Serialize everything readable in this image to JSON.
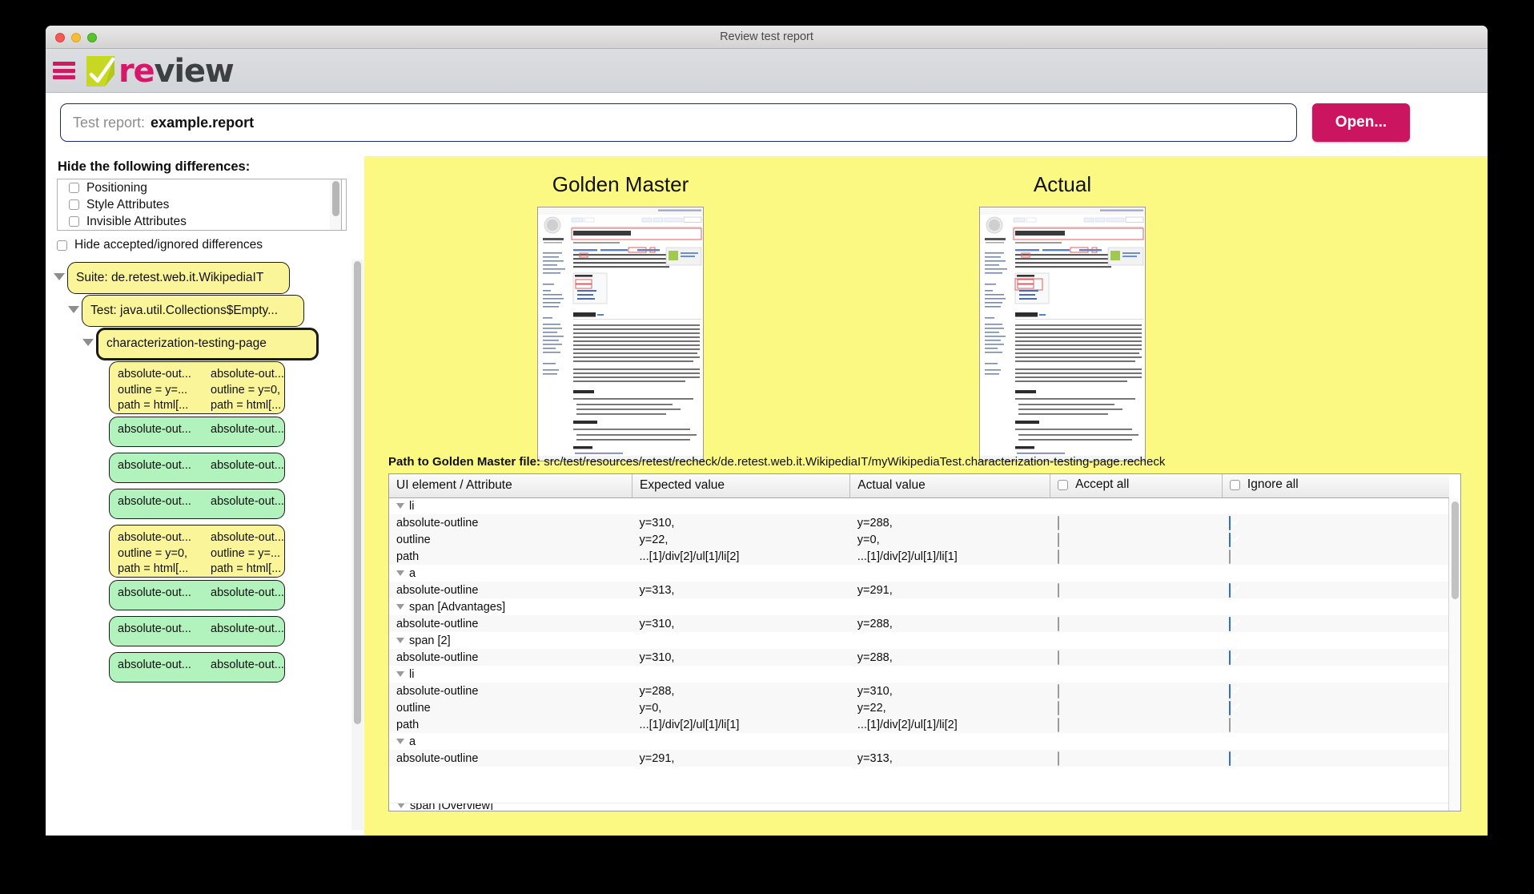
{
  "window": {
    "title": "Review test report",
    "traffic_lights": [
      "close-red",
      "minimize-yellow",
      "maximize-green"
    ]
  },
  "header": {
    "menu_icon": "hamburger-menu-icon",
    "logo_text_1": "re",
    "logo_text_2": "view",
    "logo_mark": "check-mark-icon",
    "brand_pink": "#cc1a63",
    "brand_green": "#c6d822",
    "brand_dark": "#3c4043"
  },
  "toolbar": {
    "report_label": "Test report:",
    "report_value": "example.report",
    "open_label": "Open...",
    "open_color": "#cc1560"
  },
  "filters": {
    "heading": "Hide the following differences:",
    "options": [
      {
        "label": "Positioning",
        "checked": false
      },
      {
        "label": "Style Attributes",
        "checked": false
      },
      {
        "label": "Invisible Attributes",
        "checked": false
      }
    ],
    "hide_accepted": {
      "label": "Hide accepted/ignored differences",
      "checked": false
    }
  },
  "tree": {
    "suite": "Suite: de.retest.web.it.WikipediaIT",
    "test": "Test:  java.util.Collections$Empty...",
    "state": "characterization-testing-page",
    "diffs": [
      {
        "color": "yellow",
        "rows": [
          [
            "absolute-out...",
            "absolute-out..."
          ],
          [
            "outline = y=...",
            "outline = y=0,"
          ],
          [
            "path = html[...",
            "path = html[..."
          ]
        ]
      },
      {
        "color": "green",
        "rows": [
          [
            "absolute-out...",
            "absolute-out..."
          ]
        ]
      },
      {
        "color": "green",
        "rows": [
          [
            "absolute-out...",
            "absolute-out..."
          ]
        ]
      },
      {
        "color": "green",
        "rows": [
          [
            "absolute-out...",
            "absolute-out..."
          ]
        ]
      },
      {
        "color": "yellow",
        "rows": [
          [
            "absolute-out...",
            "absolute-out..."
          ],
          [
            "outline = y=0,",
            "outline = y=..."
          ],
          [
            "path = html[...",
            "path = html[..."
          ]
        ]
      },
      {
        "color": "green",
        "rows": [
          [
            "absolute-out...",
            "absolute-out..."
          ]
        ]
      },
      {
        "color": "green",
        "rows": [
          [
            "absolute-out...",
            "absolute-out..."
          ]
        ]
      },
      {
        "color": "green",
        "rows": [
          [
            "absolute-out...",
            "absolute-out..."
          ]
        ]
      }
    ]
  },
  "compare": {
    "golden_title": "Golden Master",
    "actual_title": "Actual",
    "golden_page_title": "Characterization test",
    "actual_page_title": "Difference testing",
    "page_subtitle": "From Wikipedia, the free encyclopedia",
    "section_heading": "Overview",
    "background": "#fcf982"
  },
  "path_line": {
    "label": "Path to Golden Master file:",
    "value": "src/test/resources/retest/recheck/de.retest.web.it.WikipediaIT/myWikipediaTest.characterization-testing-page.recheck"
  },
  "table": {
    "columns": [
      "UI element / Attribute",
      "Expected value",
      "Actual value",
      "Accept all",
      "Ignore all"
    ],
    "accept_all_checked": false,
    "ignore_all_checked": false,
    "rows": [
      {
        "kind": "node",
        "element": "li"
      },
      {
        "kind": "attr",
        "element": "absolute-outline",
        "expected": "y=310,",
        "actual": "y=288,",
        "accept": false,
        "ignore": true
      },
      {
        "kind": "attr",
        "element": "outline",
        "expected": "y=22,",
        "actual": "y=0,",
        "accept": false,
        "ignore": true
      },
      {
        "kind": "attr",
        "element": "path",
        "expected": "...[1]/div[2]/ul[1]/li[2]",
        "actual": "...[1]/div[2]/ul[1]/li[1]",
        "accept": false,
        "ignore": false
      },
      {
        "kind": "node",
        "element": "a"
      },
      {
        "kind": "attr",
        "element": "absolute-outline",
        "expected": "y=313,",
        "actual": "y=291,",
        "accept": false,
        "ignore": true
      },
      {
        "kind": "node",
        "element": "span [Advantages]"
      },
      {
        "kind": "attr",
        "element": "absolute-outline",
        "expected": "y=310,",
        "actual": "y=288,",
        "accept": false,
        "ignore": true
      },
      {
        "kind": "node",
        "element": "span [2]"
      },
      {
        "kind": "attr",
        "element": "absolute-outline",
        "expected": "y=310,",
        "actual": "y=288,",
        "accept": false,
        "ignore": true
      },
      {
        "kind": "node",
        "element": "li"
      },
      {
        "kind": "attr",
        "element": "absolute-outline",
        "expected": "y=288,",
        "actual": "y=310,",
        "accept": false,
        "ignore": true
      },
      {
        "kind": "attr",
        "element": "outline",
        "expected": "y=0,",
        "actual": "y=22,",
        "accept": false,
        "ignore": true
      },
      {
        "kind": "attr",
        "element": "path",
        "expected": "...[1]/div[2]/ul[1]/li[1]",
        "actual": "...[1]/div[2]/ul[1]/li[2]",
        "accept": false,
        "ignore": false
      },
      {
        "kind": "node",
        "element": "a"
      },
      {
        "kind": "attr",
        "element": "absolute-outline",
        "expected": "y=291,",
        "actual": "y=313,",
        "accept": false,
        "ignore": true
      }
    ],
    "clipped_row": "span [Overview]"
  }
}
